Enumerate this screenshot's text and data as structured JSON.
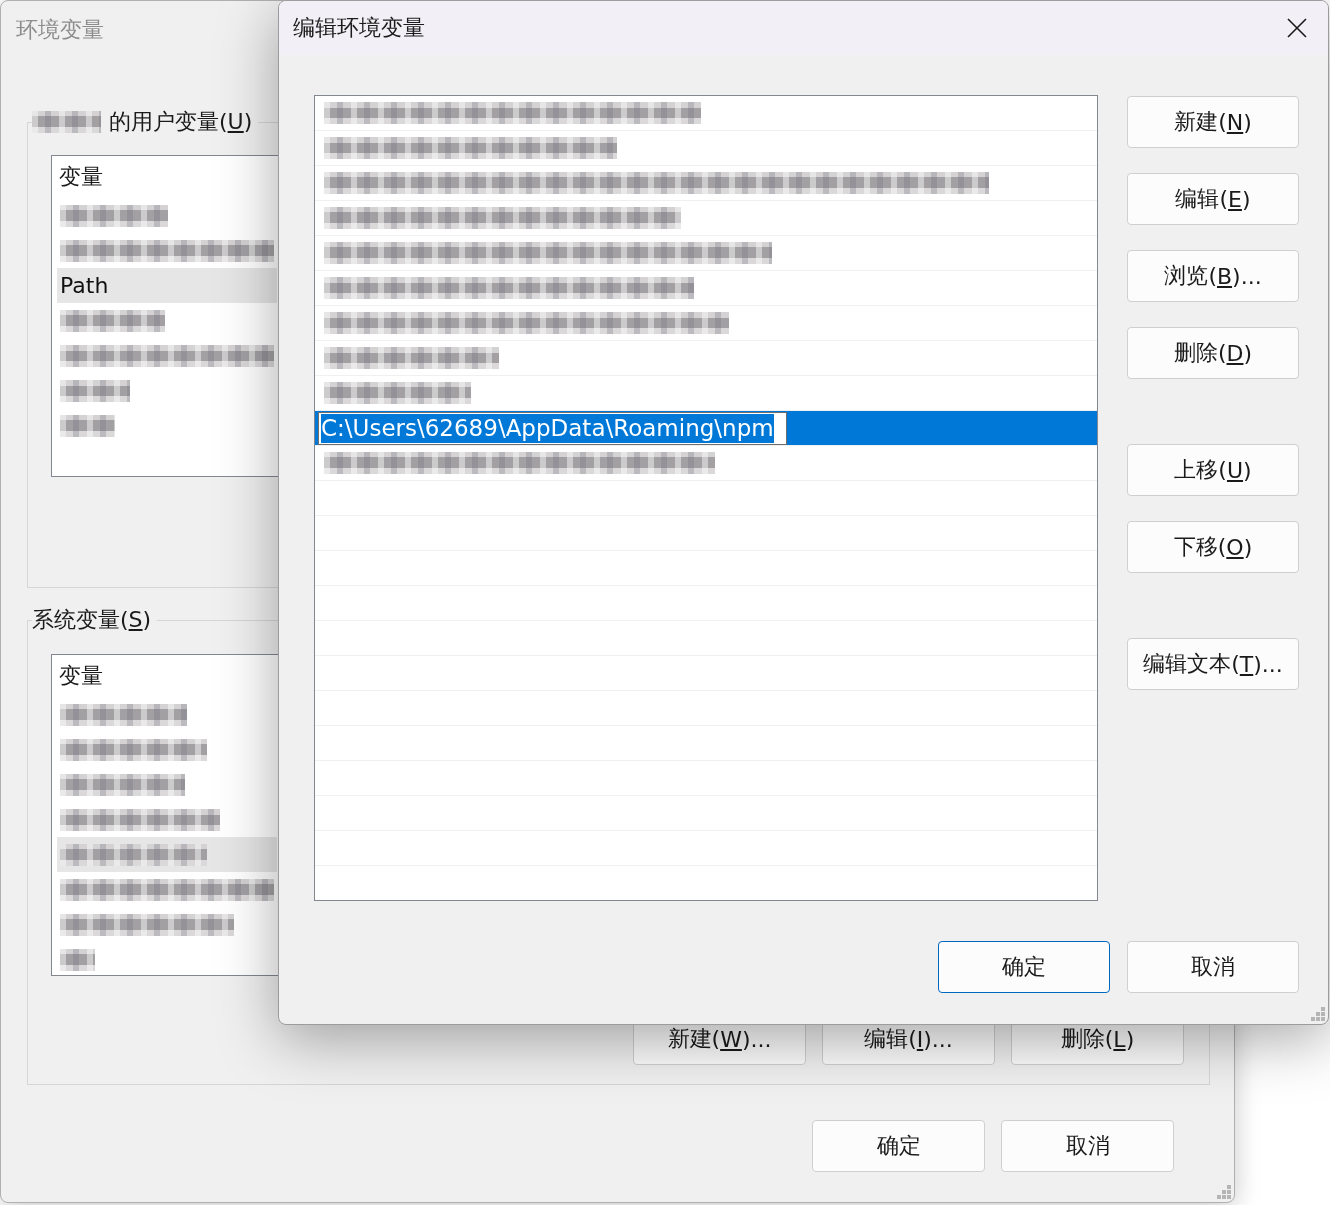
{
  "env_window": {
    "title": "环境变量",
    "active": false,
    "user_group": {
      "owner": {
        "kind": "redacted"
      },
      "text_before": "的用户变量(",
      "access_key": "U",
      "text_after": ")",
      "columns": [
        "变量"
      ],
      "rows": [
        {
          "kind": "redacted",
          "selected": false
        },
        {
          "kind": "redacted",
          "selected": false
        },
        {
          "kind": "text",
          "name": "Path",
          "selected": true
        },
        {
          "kind": "redacted",
          "selected": false
        },
        {
          "kind": "redacted",
          "selected": false
        },
        {
          "kind": "redacted",
          "selected": false
        },
        {
          "kind": "redacted",
          "selected": false
        }
      ]
    },
    "system_group": {
      "text_before": "系统变量(",
      "access_key": "S",
      "text_after": ")",
      "columns": [
        "变量"
      ],
      "rows": [
        {
          "kind": "redacted",
          "selected": false
        },
        {
          "kind": "redacted",
          "selected": false
        },
        {
          "kind": "redacted",
          "selected": false
        },
        {
          "kind": "redacted",
          "selected": false
        },
        {
          "kind": "redacted",
          "selected": true
        },
        {
          "kind": "redacted",
          "selected": false
        },
        {
          "kind": "redacted",
          "selected": false
        },
        {
          "kind": "redacted",
          "selected": false
        }
      ],
      "buttons": [
        {
          "text_before": "新建(",
          "access_key": "W",
          "text_after": ")..."
        },
        {
          "text_before": "编辑(",
          "access_key": "I",
          "text_after": ")..."
        },
        {
          "text_before": "删除(",
          "access_key": "L",
          "text_after": ")"
        }
      ]
    },
    "buttons": [
      {
        "label": "确定"
      },
      {
        "label": "取消"
      }
    ]
  },
  "edit_window": {
    "title": "编辑环境变量",
    "active": true,
    "entries": [
      {
        "kind": "redacted",
        "selected": false
      },
      {
        "kind": "redacted",
        "selected": false
      },
      {
        "kind": "redacted",
        "selected": false
      },
      {
        "kind": "redacted",
        "selected": false
      },
      {
        "kind": "redacted",
        "selected": false
      },
      {
        "kind": "redacted",
        "selected": false
      },
      {
        "kind": "redacted",
        "selected": false
      },
      {
        "kind": "redacted",
        "selected": false
      },
      {
        "kind": "redacted",
        "selected": false
      },
      {
        "kind": "editing",
        "value": "C:\\Users\\62689\\AppData\\Roaming\\npm",
        "selected": true
      },
      {
        "kind": "redacted",
        "selected": false
      }
    ],
    "side_button_groups": [
      [
        {
          "text_before": "新建(",
          "access_key": "N",
          "text_after": ")"
        },
        {
          "text_before": "编辑(",
          "access_key": "E",
          "text_after": ")"
        },
        {
          "text_before": "浏览(",
          "access_key": "B",
          "text_after": ")..."
        },
        {
          "text_before": "删除(",
          "access_key": "D",
          "text_after": ")"
        }
      ],
      [
        {
          "text_before": "上移(",
          "access_key": "U",
          "text_after": ")"
        },
        {
          "text_before": "下移(",
          "access_key": "O",
          "text_after": ")"
        }
      ],
      [
        {
          "text_before": "编辑文本(",
          "access_key": "T",
          "text_after": ")..."
        }
      ]
    ],
    "buttons": [
      {
        "label": "确定",
        "default": true
      },
      {
        "label": "取消",
        "default": false
      }
    ]
  }
}
